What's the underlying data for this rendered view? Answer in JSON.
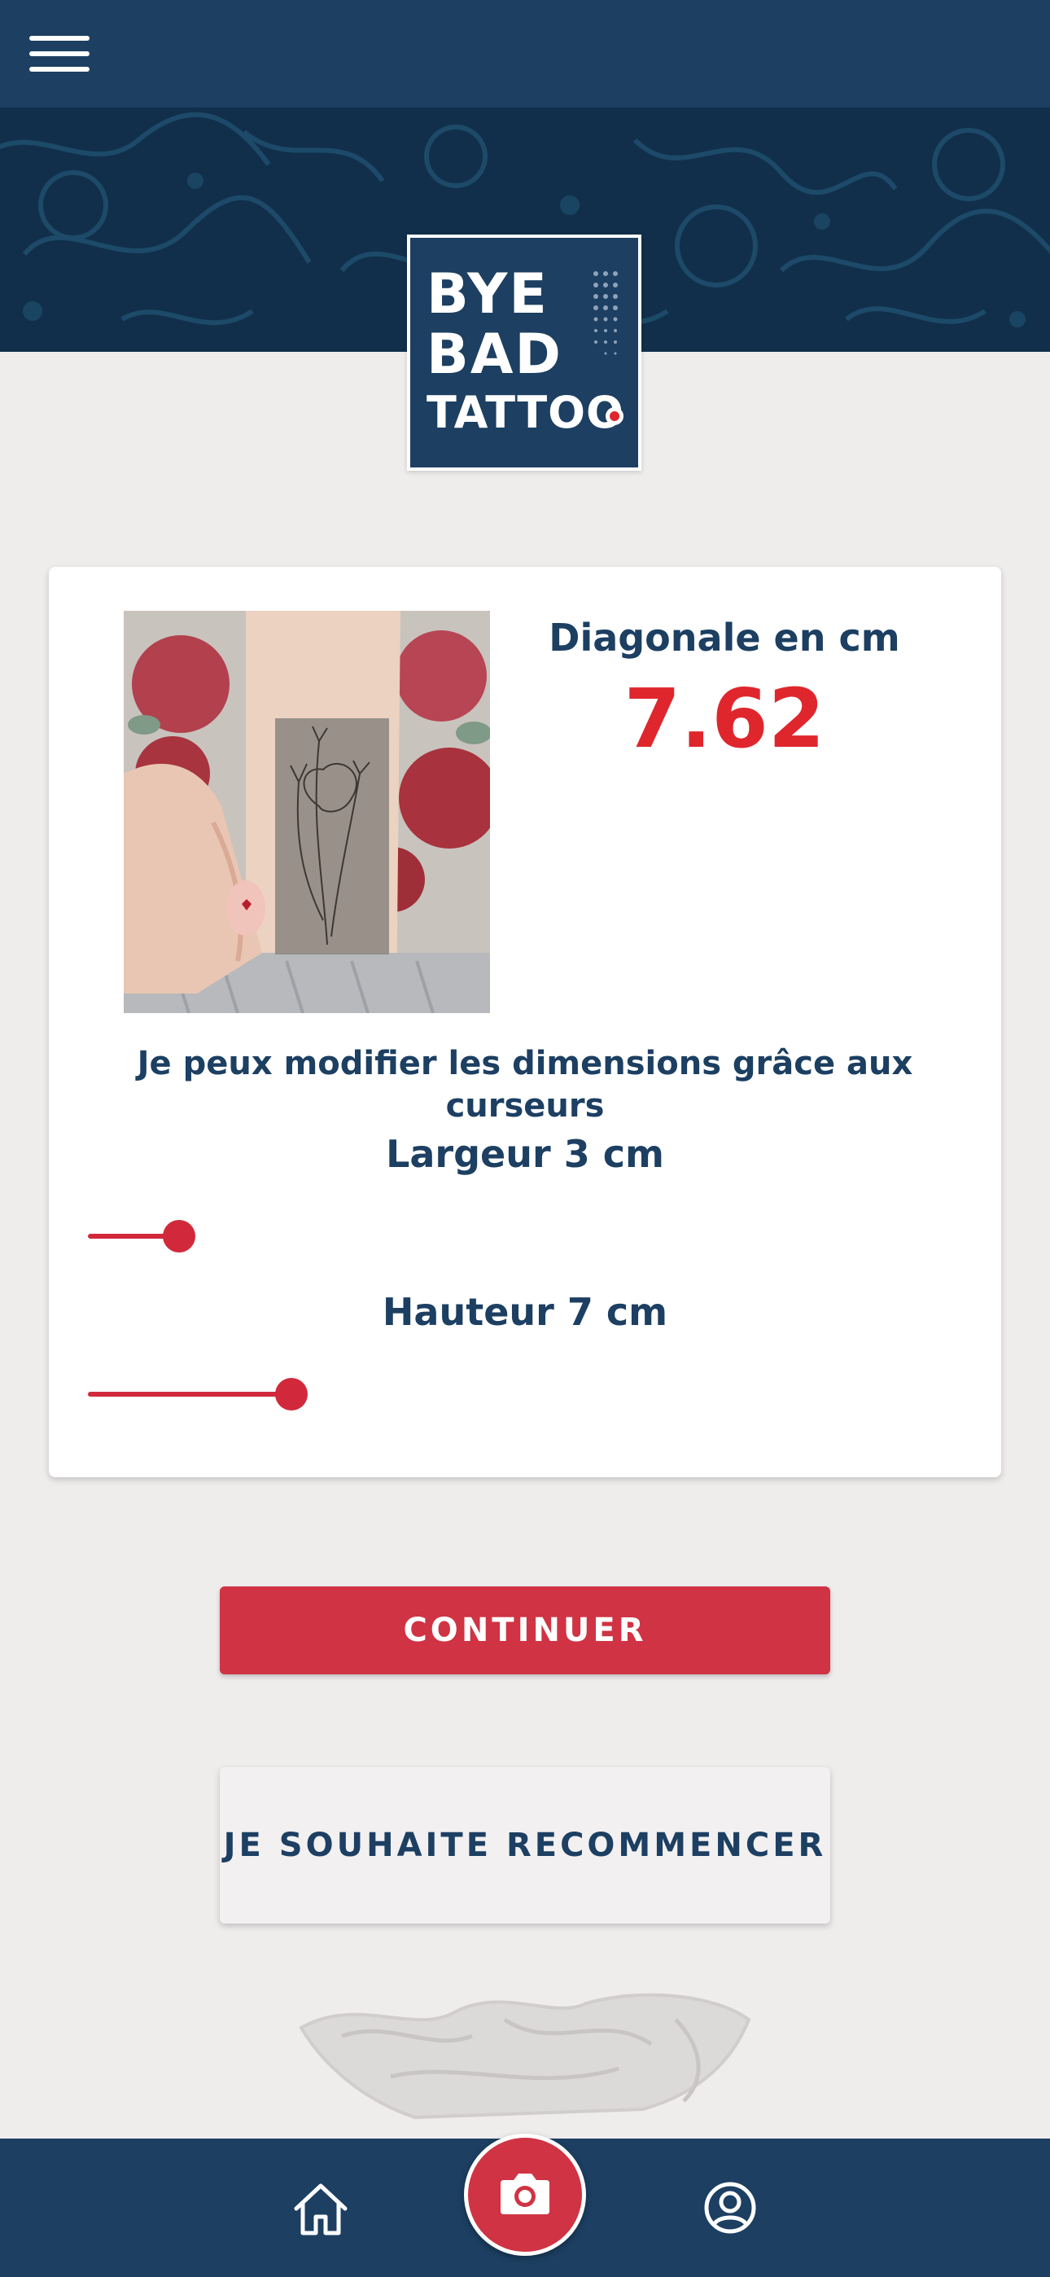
{
  "header": {
    "menu_icon": "hamburger-menu-icon"
  },
  "logo": {
    "line1": "BYE",
    "line2": "BAD",
    "line3": "TATTOO"
  },
  "card": {
    "diagonal_label": "Diagonale en cm",
    "diagonal_value": "7.62",
    "hint": "Je peux modifier les dimensions grâce aux curseurs",
    "width_label": "Largeur 3 cm",
    "height_label": "Hauteur 7 cm",
    "width_slider_value": 3,
    "height_slider_value": 7
  },
  "actions": {
    "continue_label": "CONTINUER",
    "restart_label": "JE SOUHAITE RECOMMENCER"
  },
  "bottom_nav": {
    "home_icon": "home-icon",
    "camera_icon": "camera-icon",
    "profile_icon": "user-profile-icon"
  },
  "colors": {
    "navy": "#1c3f62",
    "accent_red": "#d03343",
    "value_red": "#e0262d",
    "background": "#efecec"
  }
}
